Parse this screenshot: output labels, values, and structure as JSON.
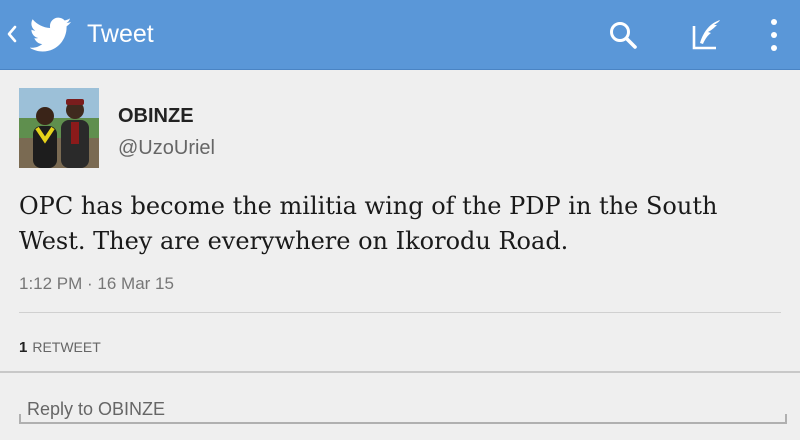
{
  "header": {
    "title": "Tweet",
    "back_icon": "chevron-left-icon",
    "logo_icon": "twitter-bird-icon",
    "search_icon": "search-icon",
    "compose_icon": "compose-quill-icon",
    "overflow_icon": "overflow-menu-icon",
    "background_color": "#5a97d8"
  },
  "tweet": {
    "display_name": "OBINZE",
    "screen_name": "@UzoUriel",
    "text": "OPC has become the militia wing of the PDP in the South West. They are everywhere on Ikorodu Road.",
    "timestamp": "1:12 PM · 16 Mar 15",
    "retweet_count": "1",
    "retweet_label": "RETWEET"
  },
  "reply": {
    "placeholder": "Reply to OBINZE"
  }
}
